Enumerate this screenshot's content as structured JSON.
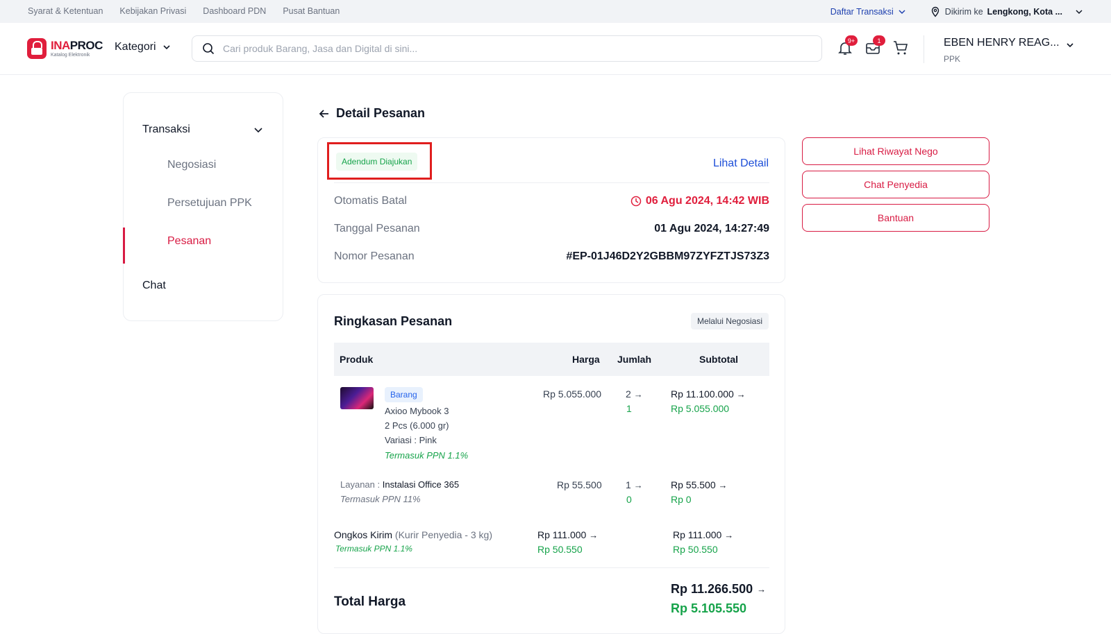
{
  "topbar": {
    "links": [
      "Syarat & Ketentuan",
      "Kebijakan Privasi",
      "Dashboard PDN",
      "Pusat Bantuan"
    ],
    "daftar_transaksi": "Daftar Transaksi",
    "dikirim_label": "Dikirim ke",
    "dikirim_value": "Lengkong, Kota ..."
  },
  "header": {
    "logo_brand_a": "INA",
    "logo_brand_b": "PROC",
    "logo_sub": "Katalog Elektronik",
    "kategori": "Kategori",
    "search_placeholder": "Cari produk Barang, Jasa dan Digital di sini...",
    "notif_badge": "9+",
    "inbox_badge": "1",
    "user_name": "EBEN HENRY REAG...",
    "user_role": "PPK"
  },
  "sidebar": {
    "group": "Transaksi",
    "items": [
      "Negosiasi",
      "Persetujuan PPK",
      "Pesanan"
    ],
    "active": "Pesanan",
    "chat": "Chat"
  },
  "page": {
    "title": "Detail Pesanan"
  },
  "order": {
    "status": "Adendum Diajukan",
    "lihat_detail": "Lihat Detail",
    "rows": [
      {
        "label": "Otomatis Batal",
        "value": "06 Agu 2024, 14:42 WIB"
      },
      {
        "label": "Tanggal Pesanan",
        "value": "01 Agu 2024, 14:27:49"
      },
      {
        "label": "Nomor Pesanan",
        "value": "#EP-01J46D2Y2GBBM97ZYFZTJS73Z3"
      }
    ]
  },
  "actions": [
    "Lihat Riwayat Nego",
    "Chat Penyedia",
    "Bantuan"
  ],
  "summary": {
    "title": "Ringkasan Pesanan",
    "badge": "Melalui Negosiasi",
    "columns": [
      "Produk",
      "Harga",
      "Jumlah",
      "Subtotal"
    ],
    "product": {
      "tag": "Barang",
      "name": "Axioo Mybook 3",
      "qty_weight": "2 Pcs (6.000 gr)",
      "variasi": "Variasi   : Pink",
      "ppn": "Termasuk PPN 1.1%",
      "harga": "Rp 5.055.000",
      "jumlah_old": "2",
      "jumlah_new": "1",
      "subtotal_old": "Rp 11.100.000",
      "subtotal_new": "Rp 5.055.000"
    },
    "layanan": {
      "label": "Layanan :",
      "name": "Instalasi Office 365",
      "ppn": "Termasuk PPN 11%",
      "harga": "Rp 55.500",
      "jumlah_old": "1",
      "jumlah_new": "0",
      "subtotal_old": "Rp 55.500",
      "subtotal_new": "Rp 0"
    },
    "ongkir": {
      "label": "Ongkos Kirim",
      "detail": "(Kurir Penyedia - 3 kg)",
      "ppn": "Termasuk PPN 1.1%",
      "harga_old": "Rp 111.000",
      "harga_new": "Rp 50.550",
      "subtotal_old": "Rp 111.000",
      "subtotal_new": "Rp 50.550"
    },
    "total_label": "Total Harga",
    "total_old": "Rp 11.266.500",
    "total_new": "Rp 5.105.550"
  },
  "colors": {
    "brand_red": "#e01e3c",
    "accent_pink": "#d81b43",
    "link_blue": "#1d4ed8",
    "green": "#16a34a"
  }
}
